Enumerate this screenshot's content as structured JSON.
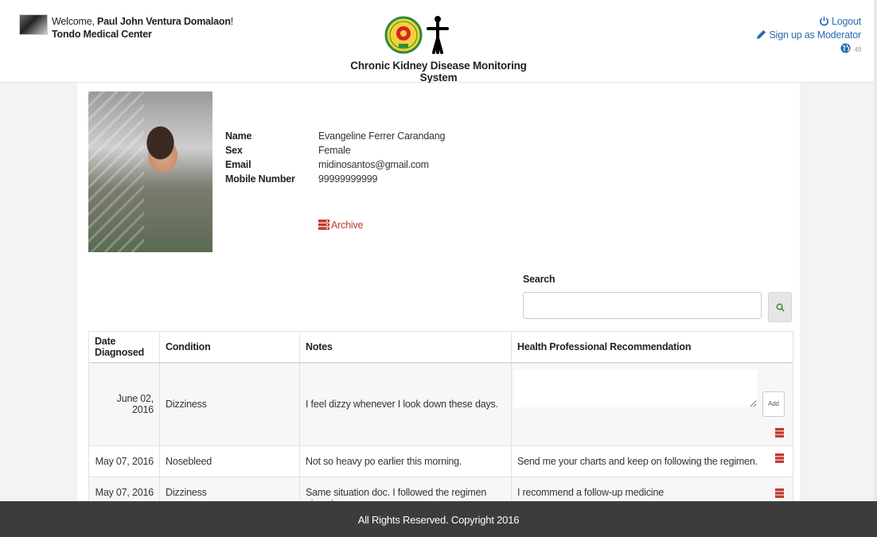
{
  "header": {
    "welcome_prefix": "Welcome, ",
    "user_name": "Paul John Ventura Domalaon",
    "welcome_suffix": "!",
    "hospital": "Tondo Medical Center",
    "system_title": "Chronic Kidney Disease Monitoring System",
    "logout_label": "Logout",
    "signup_label": "Sign up as Moderator",
    "notification_count": "49"
  },
  "patient": {
    "labels": {
      "name": "Name",
      "sex": "Sex",
      "email": "Email",
      "mobile": "Mobile Number"
    },
    "name": "Evangeline Ferrer Carandang",
    "sex": "Female",
    "email": "midinosantos@gmail.com",
    "mobile": "99999999999",
    "archive_label": "Archive"
  },
  "search": {
    "label": "Search",
    "value": ""
  },
  "table": {
    "headers": [
      "Date Diagnosed",
      "Condition",
      "Notes",
      "Health Professional Recommendation"
    ],
    "rows": [
      {
        "date": "June 02, 2016",
        "condition": "Dizziness",
        "notes": "I feel dizzy whenever I look down these days.",
        "recommendation": "",
        "add_label": "Add"
      },
      {
        "date": "May 07, 2016",
        "condition": "Nosebleed",
        "notes": "Not so heavy po earlier this morning.",
        "recommendation": "Send me your charts and keep on following the regimen."
      },
      {
        "date": "May 07, 2016",
        "condition": "Dizziness",
        "notes": "Same situation doc. I followed the regimen given to me",
        "recommendation": "I recommend a follow-up medicine"
      }
    ]
  },
  "footer": {
    "text": "All Rights Reserved. Copyright 2016"
  },
  "colors": {
    "link_blue": "#2a6bb3",
    "archive_red": "#c0392b",
    "footer_bg": "#3c3c3c"
  }
}
